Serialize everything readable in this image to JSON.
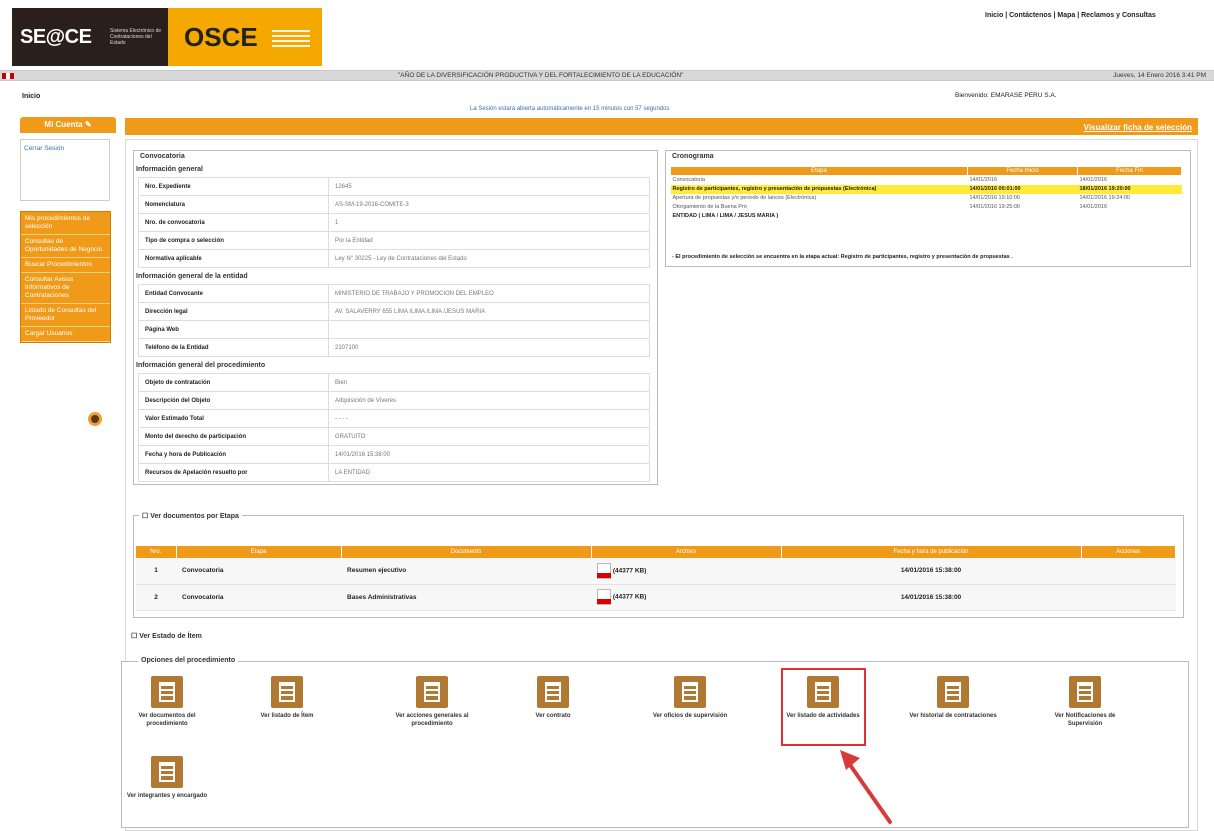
{
  "header": {
    "logo_seace": "SE@CE",
    "logo_seace_sub": "Sistema Electrónico de Contrataciones del Estado",
    "logo_osce": "OSCE",
    "top_links": "Inicio | Contáctenos | Mapa | Reclamos y Consultas"
  },
  "bar": {
    "year_title": "\"AÑO DE LA DIVERSIFICACIÓN PRODUCTIVA Y DEL FORTALECIMIENTO DE LA EDUCACIÓN\"",
    "date": "Jueves, 14 Enero 2016 3:41 PM"
  },
  "breadcrumb": "Inicio",
  "entidad": "Bienvenido: EMARASE PERU S.A.",
  "notice": "La Sesión estará abierta automáticamente en 15 minutos con 57 segundos",
  "sidebar": {
    "title": "Mi Cuenta",
    "logout": "Cerrar Sesión",
    "items": [
      "Mis procedimientos de selección",
      "Consultas de Oportunidades de Negocio",
      "Buscar Procedimientos",
      "Consultar Avisos Informativos de Contrataciones",
      "Listado de Consultas del Proveedor",
      "Cargar Usuarios"
    ]
  },
  "main": {
    "visualizar": "Visualizar ficha de selección",
    "convocatoria_title": "Convocatoria",
    "general_title": "Información general",
    "general": [
      {
        "label": "Nro. Expediente",
        "value": "12645"
      },
      {
        "label": "Nomenclatura",
        "value": "AS-SM-19-2016-COMITE-3"
      },
      {
        "label": "Nro. de convocatoria",
        "value": "1"
      },
      {
        "label": "Tipo de compra o selección",
        "value": "Por la Entidad"
      },
      {
        "label": "Normativa aplicable",
        "value": "Ley N° 30225 - Ley de Contrataciones del Estado"
      }
    ],
    "entidad_title": "Información general de la entidad",
    "entidad": [
      {
        "label": "Entidad Convocante",
        "value": "MINISTERIO DE TRABAJO Y PROMOCION DEL EMPLEO"
      },
      {
        "label": "Dirección legal",
        "value": "AV. SALAVERRY 655 LIMA /LIMA /LIMA /JESUS MARIA"
      },
      {
        "label": "Página Web",
        "value": ""
      },
      {
        "label": "Teléfono de la Entidad",
        "value": "2107100"
      }
    ],
    "procedimiento_title": "Información general del procedimiento",
    "procedimiento": [
      {
        "label": "Objeto de contratación",
        "value": "Bien"
      },
      {
        "label": "Descripción del Objeto",
        "value": "Adquisición de Víveres"
      },
      {
        "label": "Valor Estimado Total",
        "value": "- - - -"
      },
      {
        "label": "Monto del derecho de participación",
        "value": "GRATUITO"
      },
      {
        "label": "Fecha y hora de Publicación",
        "value": "14/01/2016 15:38:00"
      },
      {
        "label": "Recursos de Apelación resuelto por",
        "value": "LA ENTIDAD"
      }
    ]
  },
  "cronograma": {
    "title": "Cronograma",
    "headers": [
      "Etapa",
      "Fecha Inicio",
      "Fecha Fin"
    ],
    "rows": [
      {
        "etapa": "Convocatoria",
        "inicio": "14/01/2016",
        "fin": "14/01/2016",
        "hl": false
      },
      {
        "etapa": "Registro de participantes, registro y presentación de propuestas (Electrónica)",
        "inicio": "14/01/2016 00:01:00",
        "fin": "18/01/2016 19:20:00",
        "hl": true
      },
      {
        "etapa": "Apertura de propuestas y/o periodo de lances (Electrónica)",
        "inicio": "14/01/2016 19:10:00",
        "fin": "14/01/2016 19:24:00",
        "hl": false
      },
      {
        "etapa": "Otorgamiento de la Buena Pro",
        "inicio": "14/01/2016 19:25:00",
        "fin": "14/01/2016",
        "hl": false
      },
      {
        "etapa": "ENTIDAD ( LIMA / LIMA / JESUS MARIA )",
        "inicio": "",
        "fin": "",
        "hl": false
      }
    ],
    "note": "- El procedimiento de selección se encuentra en la etapa actual: Registro de participantes, registro y presentación de propuestas ."
  },
  "docs": {
    "toggle": "Ver documentos por Etapa",
    "headers": [
      "Nro.",
      "Etapa",
      "Documento",
      "Archivo",
      "Fecha y hora de publicación",
      "Acciones"
    ],
    "rows": [
      {
        "nro": "1",
        "etapa": "Convocatoria",
        "documento": "Resumen ejecutivo",
        "archivo": "(44377 KB)",
        "fecha": "14/01/2016 15:38:00"
      },
      {
        "nro": "2",
        "etapa": "Convocatoria",
        "documento": "Bases Administrativas",
        "archivo": "(44377 KB)",
        "fecha": "14/01/2016 15:38:00"
      }
    ]
  },
  "items_toggle": "Ver Estado de Ítem",
  "opciones": {
    "title": "Opciones del procedimiento",
    "items": [
      "Ver documentos del procedimiento",
      "Ver listado de Ítem",
      "Ver acciones generales al procedimiento",
      "Ver contrato",
      "Ver oficios de supervisión",
      "Ver listado de actividades",
      "Ver historial de contrataciones",
      "Ver Notificaciones de Supervisión",
      "Ver integrantes y encargado"
    ]
  }
}
